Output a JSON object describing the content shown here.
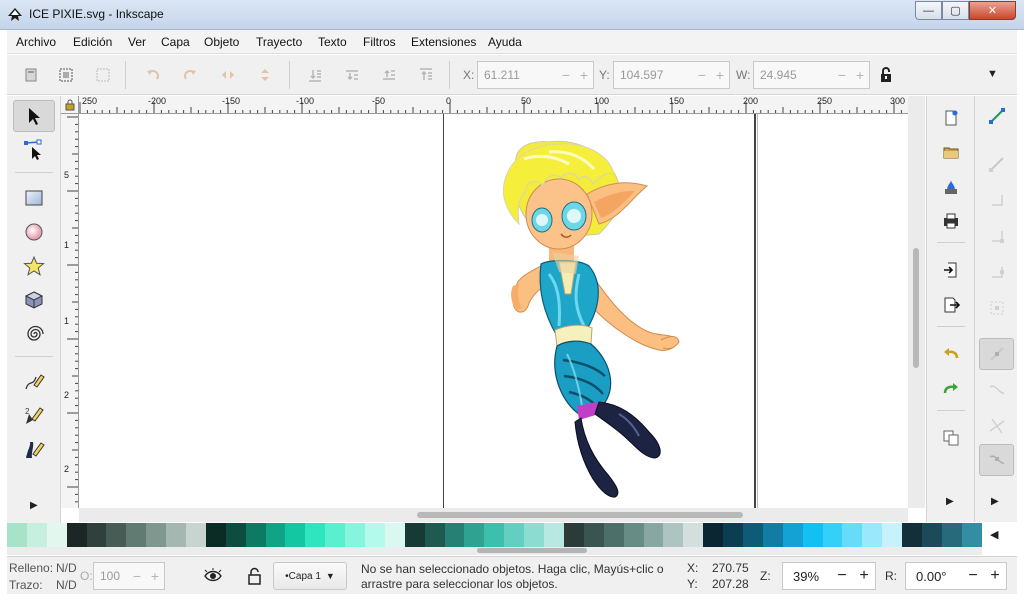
{
  "window": {
    "title": "ICE PIXIE.svg - Inkscape",
    "minimize_glyph": "—",
    "maximize_glyph": "▢",
    "close_glyph": "✕"
  },
  "menu": [
    "Archivo",
    "Edición",
    "Ver",
    "Capa",
    "Objeto",
    "Trayecto",
    "Texto",
    "Filtros",
    "Extensiones",
    "Ayuda"
  ],
  "toolbar": {
    "x_label": "X:",
    "x_value": "61.211",
    "y_label": "Y:",
    "y_value": "104.597",
    "w_label": "W:",
    "w_value": "24.945",
    "minus": "−",
    "plus": "+",
    "more_glyph": "▼"
  },
  "ruler": {
    "top_labels": [
      "250",
      "-200",
      "-150",
      "-100",
      "-50",
      "0",
      "50",
      "100",
      "150",
      "200",
      "250",
      "300"
    ],
    "left_labels": [
      "5",
      "1",
      "1",
      "2",
      "2"
    ]
  },
  "palette": {
    "colors": [
      "#a6e3c9",
      "#c7efdf",
      "#e2f7ee",
      "#1c2624",
      "#30403c",
      "#485c56",
      "#617a72",
      "#7f978f",
      "#a5b7b1",
      "#c8d4d0",
      "#0b2b25",
      "#0d4d40",
      "#0f7a64",
      "#11a386",
      "#14c7a3",
      "#2ee5c0",
      "#59efcf",
      "#86f5de",
      "#b3f9ec",
      "#daf8f0",
      "#173b34",
      "#1e5a4f",
      "#268073",
      "#2fa291",
      "#3dbfad",
      "#64cfc0",
      "#8ddcd1",
      "#b8e8e1",
      "#2b3b38",
      "#3a5450",
      "#4c6f69",
      "#678b85",
      "#89a7a2",
      "#aec4c0",
      "#d2dfdd",
      "#0a2633",
      "#0c3e52",
      "#0e5b78",
      "#127da4",
      "#14a2d5",
      "#10c1f2",
      "#35d0f7",
      "#66dcfa",
      "#99e8fc",
      "#c7f2fd",
      "#13303a",
      "#1b4a58",
      "#276a7c",
      "#338ea4"
    ],
    "arrow": "◀"
  },
  "status": {
    "fill_label": "Relleno:",
    "fill_value": "N/D",
    "stroke_label": "Trazo:",
    "stroke_value": "N/D",
    "opacity_label": "O:",
    "opacity_value": "100",
    "layer": "•Capa 1",
    "message_line1": "No se han seleccionado objetos. Haga clic, Mayús+clic o",
    "message_line2": "arrastre para seleccionar los objetos.",
    "cursor_x_label": "X:",
    "cursor_x": "270.75",
    "cursor_y_label": "Y:",
    "cursor_y": "207.28",
    "zoom_label": "Z:",
    "zoom": "39%",
    "rotation_label": "R:",
    "rotation": "0.00°"
  }
}
